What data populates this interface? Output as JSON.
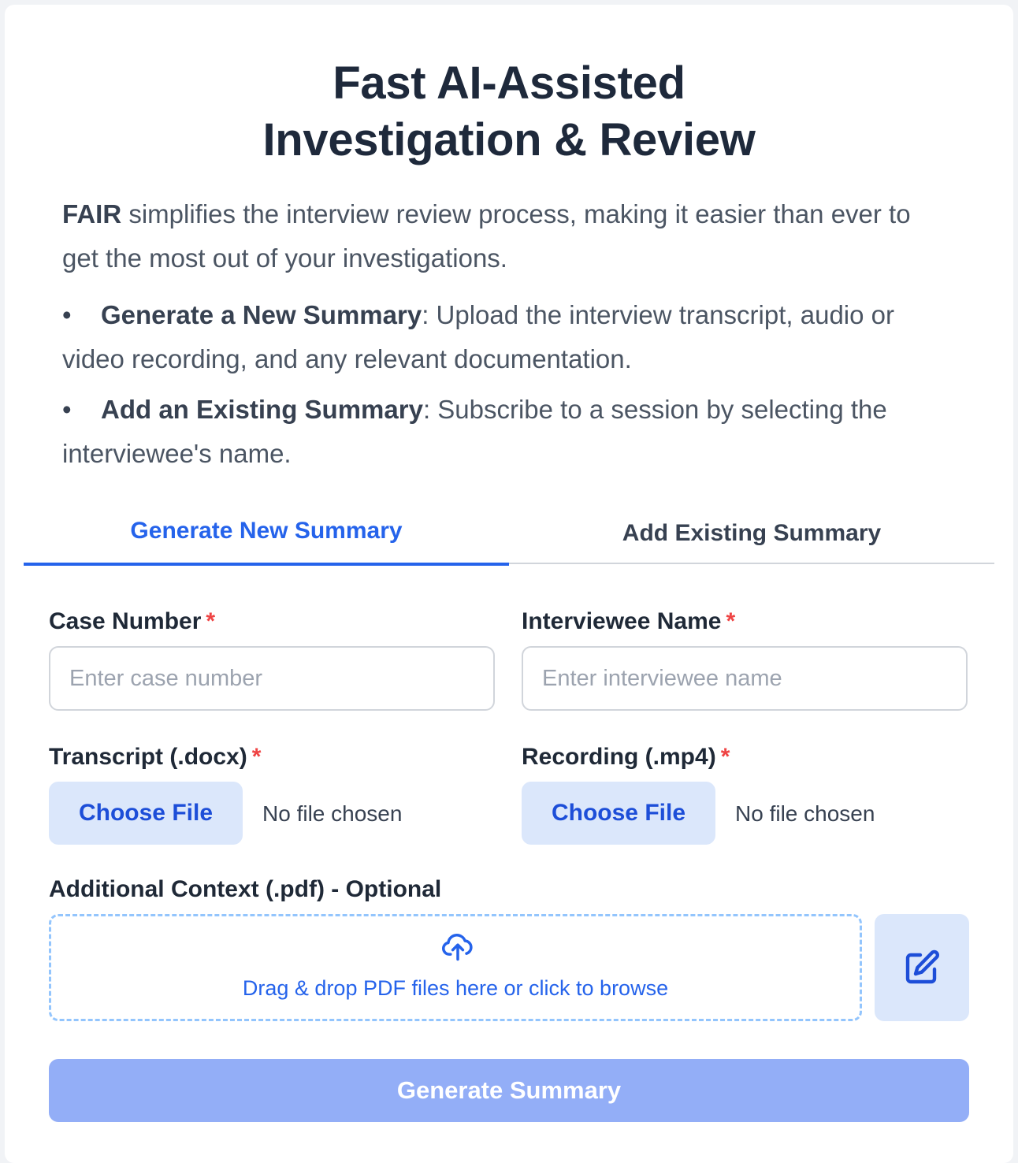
{
  "header": {
    "title_line1": "Fast AI-Assisted",
    "title_line2": "Investigation & Review"
  },
  "intro": {
    "brand": "FAIR",
    "text": " simplifies the interview review process, making it easier than ever to get the most out of your investigations."
  },
  "bullets": [
    {
      "bold": "Generate a New Summary",
      "text": ": Upload the interview transcript, audio or video recording, and any relevant documentation."
    },
    {
      "bold": "Add an Existing Summary",
      "text": ": Subscribe to a session by selecting the interviewee's name."
    }
  ],
  "bullet_symbol": "•",
  "tabs": [
    {
      "label": "Generate New Summary",
      "active": true
    },
    {
      "label": "Add Existing Summary",
      "active": false
    }
  ],
  "form": {
    "required_mark": "*",
    "case_number": {
      "label": "Case Number",
      "placeholder": "Enter case number",
      "value": ""
    },
    "interviewee_name": {
      "label": "Interviewee Name",
      "placeholder": "Enter interviewee name",
      "value": ""
    },
    "transcript": {
      "label": "Transcript (.docx)",
      "button": "Choose File",
      "status": "No file chosen"
    },
    "recording": {
      "label": "Recording (.mp4)",
      "button": "Choose File",
      "status": "No file chosen"
    },
    "additional_context": {
      "label": "Additional Context (.pdf) - Optional",
      "dropzone_text": "Drag & drop PDF files here or click to browse",
      "dropzone_icon": "cloud-upload-icon",
      "edit_icon": "edit-icon"
    },
    "submit_label": "Generate Summary"
  },
  "colors": {
    "accent": "#2563eb",
    "required": "#ef4444",
    "submit_disabled": "#93aef7",
    "file_button_bg": "#dbe7fb"
  }
}
